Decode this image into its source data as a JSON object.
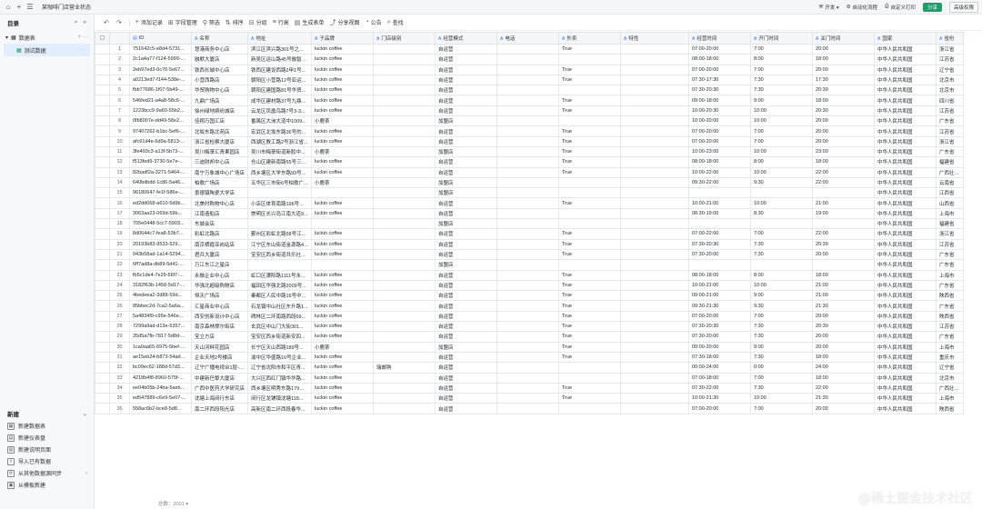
{
  "topbar": {
    "title": "某咖啡门店营业状态",
    "items": [
      {
        "icon": "home-icon",
        "label": ""
      },
      {
        "icon": "plus-icon",
        "label": ""
      },
      {
        "icon": "menu-icon",
        "label": ""
      }
    ],
    "right": [
      {
        "icon": "dev-icon",
        "label": "开发 ▾"
      },
      {
        "icon": "automation-icon",
        "label": "自动化流程"
      },
      {
        "icon": "print-icon",
        "label": "自定义打印"
      }
    ],
    "share": "分享",
    "advanced": "高级权限"
  },
  "sidebar": {
    "title": "目录",
    "tables": [
      {
        "label": "数据表"
      },
      {
        "label": "测试数据"
      }
    ],
    "new_title": "新建",
    "new_items": [
      {
        "label": "新建数据表",
        "icon": "▦"
      },
      {
        "label": "新建仪表盘",
        "icon": "▤"
      },
      {
        "label": "新建说明页面",
        "icon": "▥"
      },
      {
        "label": "导入已有数据",
        "icon": "⇪"
      },
      {
        "label": "从其他数据源同步",
        "icon": "⟳",
        "arrow": "›"
      },
      {
        "label": "从模板新建",
        "icon": "▣"
      }
    ]
  },
  "toolbar": [
    {
      "g": "↶",
      "l": ""
    },
    {
      "g": "↷",
      "l": ""
    },
    {
      "g": "+",
      "l": "添加记录"
    },
    {
      "g": "⊞",
      "l": "字段管理"
    },
    {
      "g": "⚲",
      "l": "筛选"
    },
    {
      "g": "⇅",
      "l": "排序"
    },
    {
      "g": "⊟",
      "l": "分组"
    },
    {
      "g": "≡",
      "l": "行高"
    },
    {
      "g": "▤",
      "l": "生成表单"
    },
    {
      "g": "⤴",
      "l": "分享视图"
    },
    {
      "g": "◔",
      "l": "公告"
    },
    {
      "g": "⌕",
      "l": "查找"
    }
  ],
  "columns": [
    "ID",
    "名称",
    "地址",
    "子品牌",
    "门店级别",
    "经营模式",
    "电话",
    "外卖",
    "特性",
    "经营时间",
    "开门时间",
    "关门时间",
    "国家",
    "省份"
  ],
  "rows": [
    [
      "751642c5-e8d4-5731...",
      "慧港商务中心店",
      "滨江区滨兴路301号之...",
      "luckin coffee",
      "",
      "自运营",
      "",
      "True",
      "",
      "07:00-20:00",
      "7:00",
      "20:00",
      "中华人民共和国",
      "浙江省"
    ],
    [
      "2c1a4a77-f124-5999-...",
      "融默大厦店",
      "新吴区运山路45号融智大...",
      "luckin coffee",
      "",
      "自运营",
      "",
      "",
      "",
      "08:00-18:00",
      "8:00",
      "18:00",
      "中华人民共和国",
      "江苏省"
    ],
    [
      "2eb97ed3-0c76-5e67...",
      "铁西长城中心店",
      "铁西区建设西路2甲1号...",
      "luckin coffee",
      "",
      "自运营",
      "",
      "True",
      "",
      "07:00-20:00",
      "7:00",
      "20:00",
      "中华人民共和国",
      "辽宁省"
    ],
    [
      "a0213ed7-f144-538e-...",
      "小营西路店",
      "朝阳区小营路12号亚运...",
      "luckin coffee",
      "",
      "自运营",
      "",
      "True",
      "",
      "07:30-17:30",
      "7:30",
      "17:30",
      "中华人民共和国",
      "北京市"
    ],
    [
      "fbb77686-1f07-5b49-...",
      "华贸购物中心店",
      "朝阳区建国路81号华贸...",
      "luckin coffee",
      "",
      "自运营",
      "",
      "",
      "",
      "07:30-20:30",
      "7:30",
      "20:30",
      "中华人民共和国",
      "北京市"
    ],
    [
      "546fed21-a4a8-58c6-...",
      "九鼎广场店",
      "成华区建材路37号九鼎...",
      "luckin coffee",
      "",
      "自运营",
      "",
      "True",
      "",
      "09:00-18:00",
      "9:00",
      "18:00",
      "中华人民共和国",
      "四川省"
    ],
    [
      "1223bcc9-9a60-55b2...",
      "徐州绿地缤纷城店",
      "云龙区凤凰鸟路7号3-3...",
      "luckin coffee",
      "",
      "自运营",
      "",
      "True",
      "",
      "10:00-20:30",
      "10:00",
      "20:30",
      "中华人民共和国",
      "江苏省"
    ],
    [
      "0fb8007e-dd49-58e2...",
      "佳翔万国汇店",
      "番禺区大洲大道中1009...",
      "小鹿茶",
      "",
      "加盟店",
      "",
      "",
      "",
      "10:00-20:00",
      "10:00",
      "20:00",
      "中华人民共和国",
      "广东省"
    ],
    [
      "97407262-b1bc-5ef6-...",
      "北坂东路北苑店",
      "宏武区北坂东路36号的...",
      "luckin coffee",
      "",
      "自运营",
      "",
      "True",
      "",
      "07:00-20:00",
      "7:00",
      "20:00",
      "中华人民共和国",
      "江苏省"
    ],
    [
      "afc61d4e-6d9a-5813-...",
      "浙江省检察大厦店",
      "西湖区教工路2号浙江省...",
      "luckin coffee",
      "",
      "自运营",
      "",
      "True",
      "",
      "07:00-20:00",
      "7:00",
      "20:00",
      "中华人民共和国",
      "浙江省"
    ],
    [
      "3fe493c3-a13f-5b73-...",
      "吴川梅菉汇青果园店",
      "吴川市梅菉街道新胶中...",
      "小鹿茶",
      "",
      "加盟店",
      "",
      "True",
      "",
      "10:00-23:00",
      "10:00",
      "23:00",
      "中华人民共和国",
      "广东省"
    ],
    [
      "f513fed9-3730-5e7e-...",
      "三迪财邦中心店",
      "仓山区建新南路55号三迪...",
      "luckin coffee",
      "",
      "自运营",
      "",
      "True",
      "",
      "08:00-18:00",
      "8:00",
      "18:00",
      "中华人民共和国",
      "福建省"
    ],
    [
      "82badf2a-3271-5464-...",
      "南宁万象城中心广场店",
      "西乡塘区大学东路93号...",
      "luckin coffee",
      "",
      "自运营",
      "",
      "True",
      "",
      "10:00-22:00",
      "10:00",
      "22:00",
      "中华人民共和国",
      "广西壮族自治区"
    ],
    [
      "640bdbdd-1c86-5a46...",
      "柏歌广场店",
      "五华区三市街6号柏歌广...",
      "小鹿茶",
      "",
      "加盟店",
      "",
      "",
      "",
      "09:30-22:00",
      "9:30",
      "22:00",
      "中华人民共和国",
      "云南省"
    ],
    [
      "96180647-fe1f-586e-...",
      "景德镇陶瓷大学店",
      "",
      "",
      "",
      "加盟店",
      "",
      "",
      "",
      "",
      "",
      "",
      "中华人民共和国",
      "江西省"
    ],
    [
      "ed2dd068-a610-5d9b...",
      "北美时购物中心店",
      "小店区体育南路196号...",
      "luckin coffee",
      "",
      "自运营",
      "",
      "True",
      "",
      "10:00-21:00",
      "10:00",
      "21:00",
      "中华人民共和国",
      "山西省"
    ],
    [
      "3063aa23-069d-59b...",
      "江南造船店",
      "崇明区长兴岛江南大道9...",
      "luckin coffee",
      "",
      "自运营",
      "",
      "",
      "",
      "08:30-19:00",
      "8:30",
      "19:00",
      "中华人民共和国",
      "上海市"
    ],
    [
      "705e0448-5cc7-5903...",
      "东城会店",
      "",
      "",
      "",
      "加盟店",
      "",
      "",
      "",
      "",
      "",
      "",
      "中华人民共和国",
      "福建省"
    ],
    [
      "8d0644c7-fea8-53b7...",
      "彩虹北路店",
      "鄞州区彩虹北路58号江...",
      "luckin coffee",
      "",
      "自运营",
      "",
      "True",
      "",
      "07:00-22:00",
      "7:00",
      "22:00",
      "中华人民共和国",
      "浙江省"
    ],
    [
      "20193b83-9533-529...",
      "南京栖霞亚岗站店",
      "江宁区东山街道金源路4...",
      "luckin coffee",
      "",
      "自运营",
      "",
      "True",
      "",
      "07:30-20:30",
      "7:30",
      "20:30",
      "中华人民共和国",
      "江苏省"
    ],
    [
      "043b58ad-1a14-5294...",
      "君兵大厦店",
      "宝安区西乡街道共乐社...",
      "luckin coffee",
      "",
      "自运营",
      "",
      "True",
      "",
      "07:30-20:00",
      "7:30",
      "20:00",
      "中华人民共和国",
      "广东省"
    ],
    [
      "6ff7ad8a-db89-5d41-...",
      "万江东江之星店",
      "",
      "",
      "",
      "加盟店",
      "",
      "",
      "",
      "",
      "",
      "",
      "中华人民共和国",
      "广东省"
    ],
    [
      "fb5c1de4-7e29-56f7-...",
      "永融企业中心店",
      "虹口区溧阳路1111号永...",
      "luckin coffee",
      "",
      "自运营",
      "",
      "True",
      "",
      "08:00-18:00",
      "8:00",
      "18:00",
      "中华人民共和国",
      "上海市"
    ],
    [
      "3182f63b-1458-5d17-...",
      "华强北超级购物店",
      "福田区华强北路2009号...",
      "luckin coffee",
      "",
      "自运营",
      "",
      "True",
      "",
      "10:00-21:00",
      "10:00",
      "21:00",
      "中华人民共和国",
      "广东省"
    ],
    [
      "4bedeea2-3d88-59d...",
      "恒天广场店",
      "秦都区人民中路16号中...",
      "luckin coffee",
      "",
      "自运营",
      "",
      "True",
      "",
      "09:00-21:00",
      "9:00",
      "21:00",
      "中华人民共和国",
      "陕西省"
    ],
    [
      "85bbec2d-7ca2-5a6a...",
      "汇星商业中心店",
      "石龙镇中山社区东升路1...",
      "luckin coffee",
      "",
      "自运营",
      "",
      "True",
      "",
      "09:30-21:30",
      "9:30",
      "21:30",
      "中华人民共和国",
      "广东省"
    ],
    [
      "5a4834f9-c95e-546e...",
      "西安创新设计中心店",
      "碑林区二环南路西段69...",
      "luckin coffee",
      "",
      "自运营",
      "",
      "True",
      "",
      "07:00-20:00",
      "7:00",
      "20:00",
      "中华人民共和国",
      "陕西省"
    ],
    [
      "7299a9ad-d13e-5357...",
      "南京森林摩尔街店",
      "玄武区中山门大街301...",
      "luckin coffee",
      "",
      "自运营",
      "",
      "True",
      "",
      "07:30-20:30",
      "7:30",
      "20:30",
      "中华人民共和国",
      "江苏省"
    ],
    [
      "35d5a7fb-7817-5d8d-...",
      "宝立方店",
      "宝安区西乡街道新安四...",
      "luckin coffee",
      "",
      "自运营",
      "",
      "True",
      "",
      "07:30-20:00",
      "7:30",
      "20:00",
      "中华人民共和国",
      "广东省"
    ],
    [
      "1ca0aa65-6975-5bef-...",
      "天山河畔花园店",
      "长宁区天山西路189号...",
      "小鹿茶",
      "",
      "加盟店",
      "",
      "True",
      "",
      "09:00-20:00",
      "9:00",
      "20:00",
      "中华人民共和国",
      "上海市"
    ],
    [
      "ae15eb24-b873-54ad...",
      "企业天地2号楼店",
      "渝中区华盛路10号企业...",
      "luckin coffee",
      "",
      "自运营",
      "",
      "True",
      "",
      "07:30-18:00",
      "7:30",
      "18:00",
      "中华人民共和国",
      "重庆市"
    ],
    [
      "bc09ec62-188d-57d3...",
      "辽宁广播电视台1层-瑞...",
      "辽宁省沈阳市和平区青...",
      "luckin coffee",
      "瑞邮购",
      "自运营",
      "",
      "",
      "",
      "00:00-24:00",
      "0:00",
      "24:00",
      "中华人民共和国",
      "辽宁省"
    ],
    [
      "4218b4f8-8960-575f-...",
      "中建新巴黎大厦店",
      "大兴区西红门镇华华路...",
      "luckin coffee",
      "",
      "自运营",
      "",
      "",
      "",
      "07:00-18:00",
      "7:00",
      "18:00",
      "中华人民共和国",
      "北京市"
    ],
    [
      "ee04b05b-24ba-5aeb...",
      "广西中医药大学研究店",
      "西乡塘区明秀东路179号...",
      "luckin coffee",
      "",
      "自运营",
      "",
      "True",
      "",
      "07:30-22:00",
      "7:30",
      "22:00",
      "中华人民共和国",
      "广西壮族自治区"
    ],
    [
      "ed547889-c6e9-5e07-...",
      "沈塘上海闵行东店",
      "闵行区龙铺镇沈塘118...",
      "luckin coffee",
      "",
      "自运营",
      "",
      "True",
      "",
      "10:00-21:30",
      "10:00",
      "21:30",
      "中华人民共和国",
      "上海市"
    ],
    [
      "558ac6b2-bce8-5d8...",
      "南二环西段阳光店",
      "高新区南二环西段春华...",
      "luckin coffee",
      "",
      "自运营",
      "",
      "",
      "",
      "07:00-20:00",
      "7:00",
      "20:00",
      "中华人民共和国",
      "陕西省"
    ]
  ],
  "status": {
    "count": "总数：2001 ▾"
  },
  "watermark": "@稀土掘金技术社区"
}
